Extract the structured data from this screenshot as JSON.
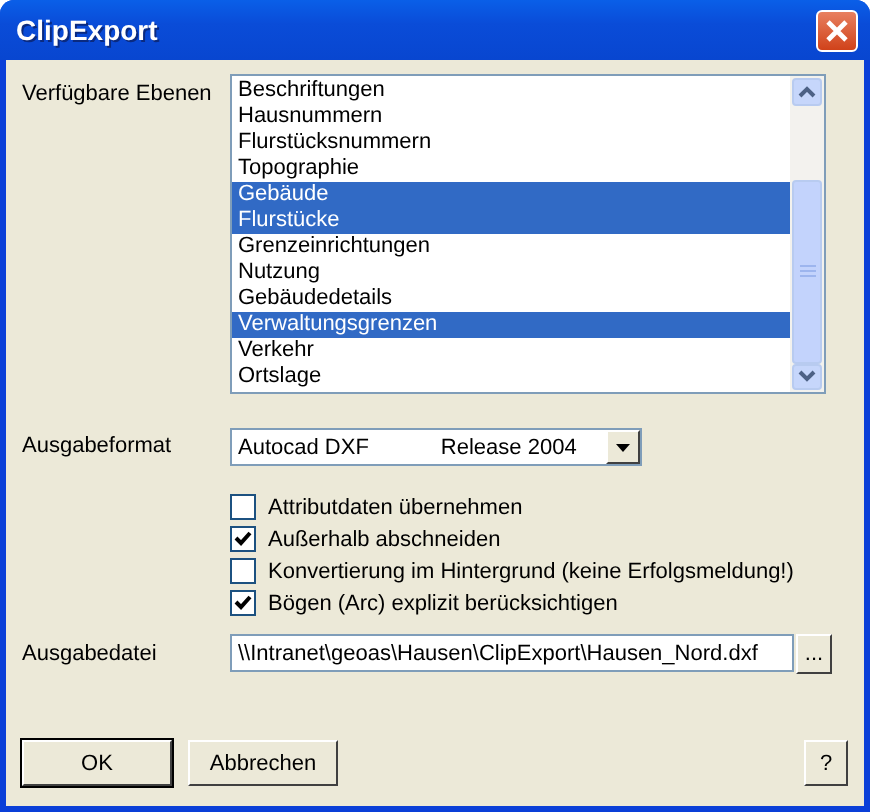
{
  "window": {
    "title": "ClipExport"
  },
  "layers": {
    "label": "Verfügbare Ebenen",
    "items": [
      {
        "name": "Beschriftungen",
        "selected": false
      },
      {
        "name": "Hausnummern",
        "selected": false
      },
      {
        "name": "Flurstücksnummern",
        "selected": false
      },
      {
        "name": "Topographie",
        "selected": false
      },
      {
        "name": "Gebäude",
        "selected": true
      },
      {
        "name": "Flurstücke",
        "selected": true
      },
      {
        "name": "Grenzeinrichtungen",
        "selected": false
      },
      {
        "name": "Nutzung",
        "selected": false
      },
      {
        "name": "Gebäudedetails",
        "selected": false
      },
      {
        "name": "Verwaltungsgrenzen",
        "selected": true
      },
      {
        "name": "Verkehr",
        "selected": false
      },
      {
        "name": "Ortslage",
        "selected": false
      }
    ]
  },
  "format": {
    "label": "Ausgabeformat",
    "value_parts": [
      "Autocad DXF",
      "Release 2004"
    ]
  },
  "options": [
    {
      "label": "Attributdaten übernehmen",
      "checked": false
    },
    {
      "label": "Außerhalb abschneiden",
      "checked": true
    },
    {
      "label": "Konvertierung im Hintergrund (keine Erfolgsmeldung!)",
      "checked": false
    },
    {
      "label": "Bögen (Arc) explizit berücksichtigen",
      "checked": true
    }
  ],
  "output_file": {
    "label": "Ausgabedatei",
    "value": "\\\\Intranet\\geoas\\Hausen\\ClipExport\\Hausen_Nord.dxf",
    "browse": "..."
  },
  "buttons": [
    {
      "label": "OK",
      "kind": "default"
    },
    {
      "label": "Abbrechen",
      "kind": "normal"
    },
    {
      "label": "?",
      "kind": "help"
    }
  ]
}
